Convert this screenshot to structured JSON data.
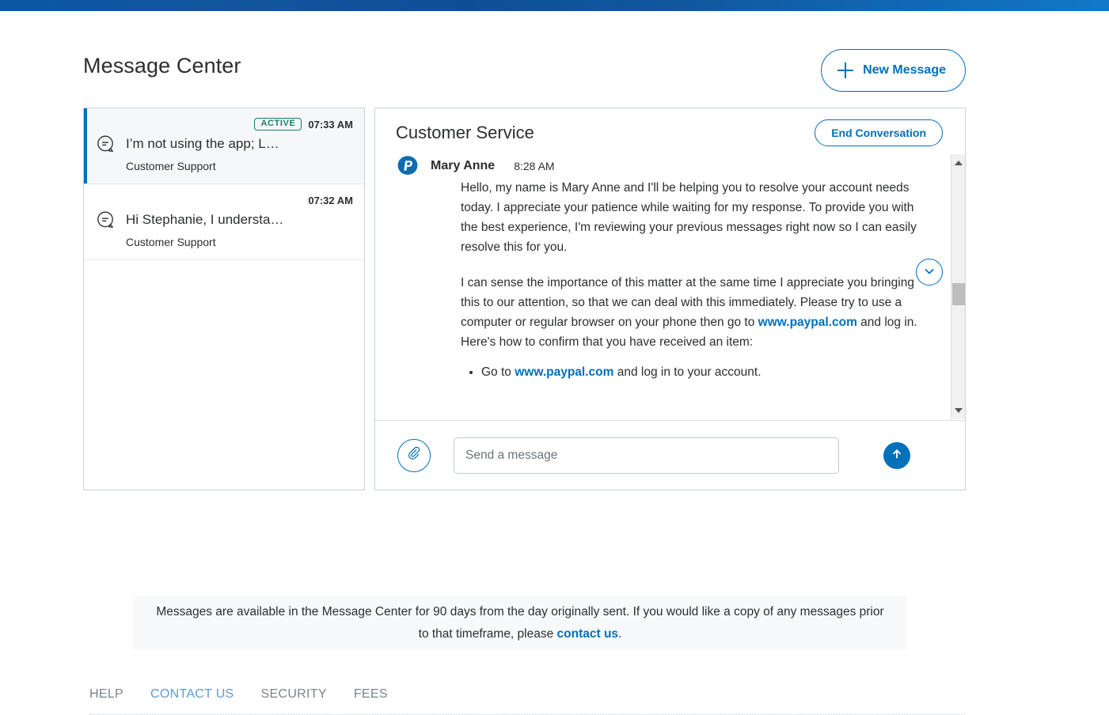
{
  "brand": {
    "accent": "#0070ba",
    "active_badge": "#1c7d6d",
    "topbar_color": "#0d4f97"
  },
  "header": {
    "title": "Message Center",
    "new_message_label": "New Message",
    "plus_icon": "plus-icon"
  },
  "threads": [
    {
      "badge": "ACTIVE",
      "time": "07:33 AM",
      "subject": "I’m not using the app; L…",
      "from": "Customer Support",
      "icon": "message-bubble-icon",
      "selected": true
    },
    {
      "badge": "",
      "time": "07:32 AM",
      "subject": "Hi Stephanie, I understa…",
      "from": "Customer Support",
      "icon": "message-bubble-icon",
      "selected": false
    }
  ],
  "conversation": {
    "title": "Customer Service",
    "end_label": "End Conversation",
    "avatar_icon": "paypal-logo-icon",
    "sender": "Mary Anne",
    "time": "8:28 AM",
    "paragraph1": "Hello, my name is Mary Anne and I'll be helping you to resolve your account needs today. I appreciate your patience while waiting for my response. To provide you with the best experience, I'm reviewing your previous messages right now so I can easily resolve this for you.",
    "paragraph2_before": "I can sense the importance of this matter at the same time I appreciate you bringing this to our attention, so that we can deal with this immediately. Please try to use a computer or regular browser on your phone then go to ",
    "paragraph2_link": "www.paypal.com",
    "paragraph2_after": " and log in.",
    "paragraph3": "Here's how to confirm that you have received an item:",
    "bullet1_before": "Go to ",
    "bullet1_link": "www.paypal.com",
    "bullet1_after": " and log in to your account.",
    "jump_icon": "chevron-down-icon",
    "scrollbar": {
      "up_icon": "scroll-up-arrow-icon",
      "down_icon": "scroll-down-arrow-icon"
    }
  },
  "composer": {
    "attach_icon": "paperclip-icon",
    "placeholder": "Send a message",
    "value": "",
    "send_icon": "arrow-up-icon"
  },
  "notice": {
    "text_before": "Messages are available in the Message Center for 90 days from the day originally sent. If you would like a copy of any messages prior to that timeframe, please ",
    "link": "contact us",
    "text_after": "."
  },
  "footer": {
    "links": [
      {
        "label": "HELP",
        "accent": false
      },
      {
        "label": "CONTACT US",
        "accent": true
      },
      {
        "label": "SECURITY",
        "accent": false
      },
      {
        "label": "FEES",
        "accent": false
      }
    ]
  }
}
